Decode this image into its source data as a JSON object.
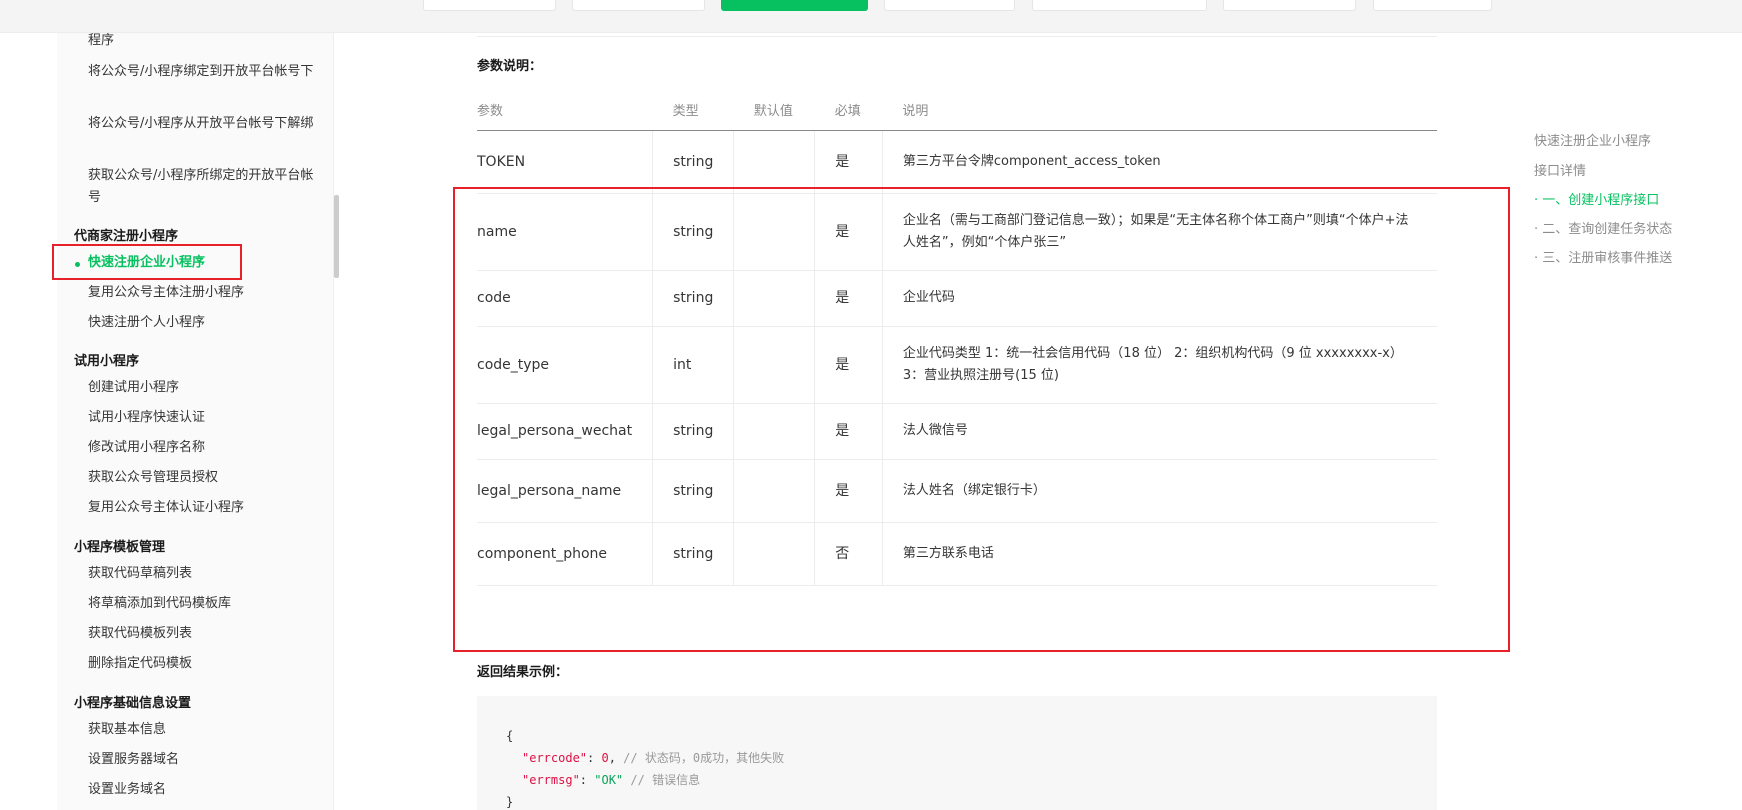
{
  "sidebar": {
    "items": [
      {
        "type": "item",
        "label": "程序",
        "top": 0
      },
      {
        "type": "item",
        "label": "将公众号/小程序绑定到开放平台帐号下"
      },
      {
        "type": "item",
        "label": "将公众号/小程序从开放平台帐号下解绑"
      },
      {
        "type": "item",
        "label": "获取公众号/小程序所绑定的开放平台帐号"
      },
      {
        "type": "group",
        "label": "代商家注册小程序"
      },
      {
        "type": "item",
        "label": "快速注册企业小程序",
        "active": true
      },
      {
        "type": "item",
        "label": "复用公众号主体注册小程序"
      },
      {
        "type": "item",
        "label": "快速注册个人小程序"
      },
      {
        "type": "group",
        "label": "试用小程序"
      },
      {
        "type": "item",
        "label": "创建试用小程序"
      },
      {
        "type": "item",
        "label": "试用小程序快速认证"
      },
      {
        "type": "item",
        "label": "修改试用小程序名称"
      },
      {
        "type": "item",
        "label": "获取公众号管理员授权"
      },
      {
        "type": "item",
        "label": "复用公众号主体认证小程序"
      },
      {
        "type": "group",
        "label": "小程序模板管理"
      },
      {
        "type": "item",
        "label": "获取代码草稿列表"
      },
      {
        "type": "item",
        "label": "将草稿添加到代码模板库"
      },
      {
        "type": "item",
        "label": "获取代码模板列表"
      },
      {
        "type": "item",
        "label": "删除指定代码模板"
      },
      {
        "type": "group",
        "label": "小程序基础信息设置"
      },
      {
        "type": "item",
        "label": "获取基本信息"
      },
      {
        "type": "item",
        "label": "设置服务器域名"
      },
      {
        "type": "item",
        "label": "设置业务域名"
      }
    ]
  },
  "main": {
    "params_title": "参数说明：",
    "result_title": "返回结果示例：",
    "table": {
      "headers": [
        "参数",
        "类型",
        "默认值",
        "必填",
        "说明"
      ],
      "rows": [
        {
          "param": "TOKEN",
          "type": "string",
          "default": "",
          "required": "是",
          "desc": "第三方平台令牌component_access_token"
        },
        {
          "param": "name",
          "type": "string",
          "default": "",
          "required": "是",
          "desc": "企业名（需与工商部门登记信息一致）；如果是“无主体名称个体工商户”则填“个体户+法人姓名”，例如“个体户张三”"
        },
        {
          "param": "code",
          "type": "string",
          "default": "",
          "required": "是",
          "desc": "企业代码"
        },
        {
          "param": "code_type",
          "type": "int",
          "default": "",
          "required": "是",
          "desc": "企业代码类型 1：统一社会信用代码（18 位） 2：组织机构代码（9 位 xxxxxxxx-x） 3：营业执照注册号(15 位)"
        },
        {
          "param": "legal_persona_wechat",
          "type": "string",
          "default": "",
          "required": "是",
          "desc": "法人微信号"
        },
        {
          "param": "legal_persona_name",
          "type": "string",
          "default": "",
          "required": "是",
          "desc": "法人姓名（绑定银行卡）"
        },
        {
          "param": "component_phone",
          "type": "string",
          "default": "",
          "required": "否",
          "desc": "第三方联系电话"
        }
      ]
    },
    "code": {
      "open": "{",
      "line1_key": "\"errcode\"",
      "line1_val": "0",
      "line1_cmt": "// 状态码，0成功，其他失败",
      "line2_key": "\"errmsg\"",
      "line2_val": "\"OK\"",
      "line2_cmt": "// 错误信息",
      "close": "}"
    }
  },
  "toc": {
    "items": [
      {
        "label": "快速注册企业小程序",
        "active": false
      },
      {
        "label": "接口详情",
        "active": false
      },
      {
        "label": "· 一、创建小程序接口",
        "active": true
      },
      {
        "label": "· 二、查询创建任务状态",
        "active": false
      },
      {
        "label": "· 三、注册审核事件推送",
        "active": false
      }
    ]
  },
  "colors": {
    "accent": "#07c160",
    "highlight_box": "#e8202a",
    "link": "#576b95"
  }
}
